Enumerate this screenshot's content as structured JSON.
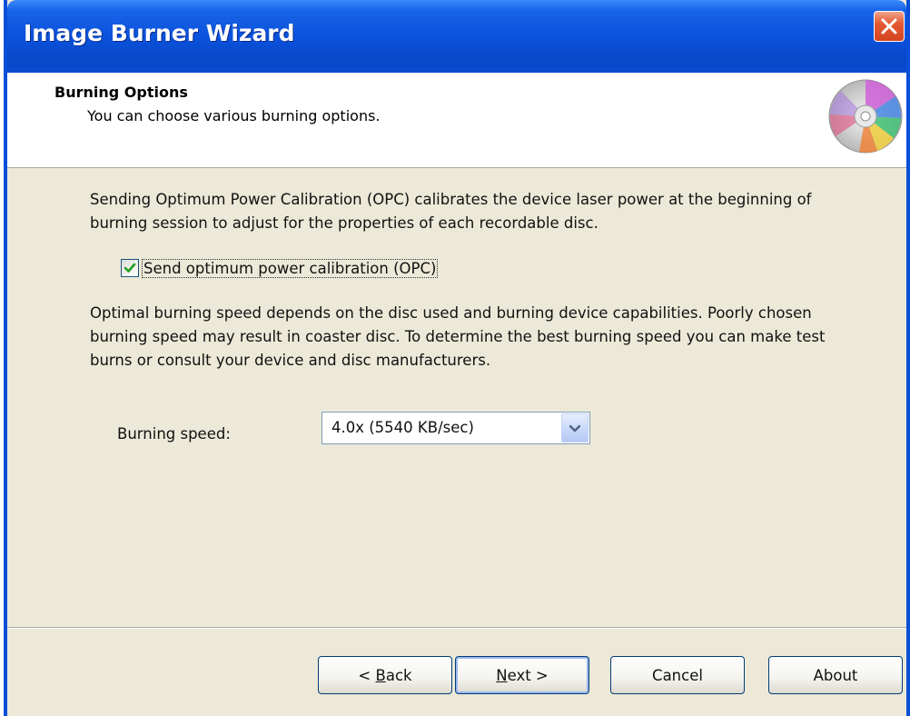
{
  "window": {
    "title": "Image Burner Wizard"
  },
  "header": {
    "title": "Burning Options",
    "subtitle": "You can choose various burning options."
  },
  "body": {
    "opc_description": "Sending Optimum Power Calibration (OPC) calibrates the device laser power at the beginning of burning session to adjust for the properties of each recordable disc.",
    "opc_checkbox": {
      "label": "Send optimum power calibration (OPC)",
      "checked": true
    },
    "speed_description": "Optimal burning speed depends on the disc used and burning device capabilities. Poorly chosen burning speed may result in coaster disc. To determine the best burning speed you can make test burns or consult your device and disc manufacturers.",
    "speed_label": "Burning speed:",
    "speed_value": "4.0x (5540 KB/sec)"
  },
  "buttons": {
    "back_prefix": "< ",
    "back_access": "B",
    "back_rest": "ack",
    "next_access": "N",
    "next_rest": "ext >",
    "cancel": "Cancel",
    "about": "About"
  },
  "icons": {
    "close": "close-icon",
    "disc": "cd-disc-icon",
    "check": "checkmark-icon",
    "dropdown": "chevron-down-icon"
  },
  "colors": {
    "titlebar": "#0a52dc",
    "window_bg": "#ece9d8",
    "close_button": "#e45a32"
  }
}
